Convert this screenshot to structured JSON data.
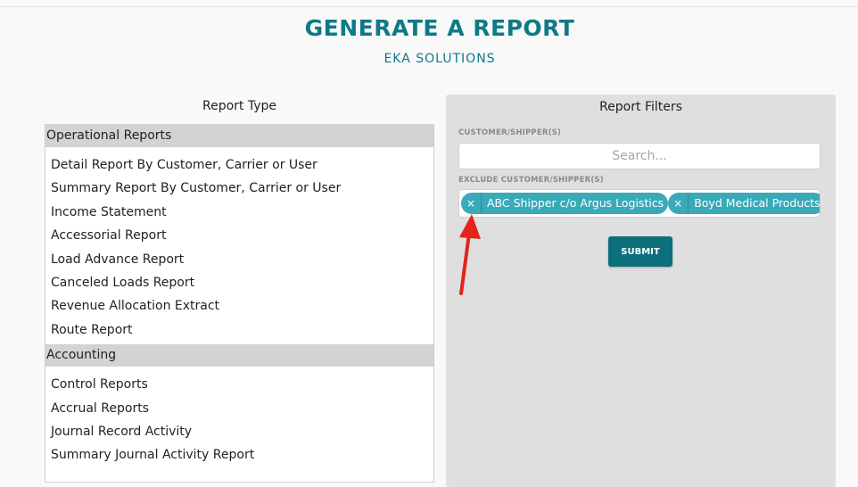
{
  "header": {
    "title": "GENERATE A REPORT",
    "subtitle": "EKA SOLUTIONS"
  },
  "report_type": {
    "heading": "Report Type",
    "groups": [
      {
        "name": "Operational Reports",
        "items": [
          "Detail Report By Customer, Carrier or User",
          "Summary Report By Customer, Carrier or User",
          "Income Statement",
          "Accessorial Report",
          "Load Advance Report",
          "Canceled Loads Report",
          "Revenue Allocation Extract",
          "Route Report"
        ]
      },
      {
        "name": "Accounting",
        "items": [
          "Control Reports",
          "Accrual Reports",
          "Journal Record Activity",
          "Summary Journal Activity Report"
        ]
      }
    ]
  },
  "filters": {
    "heading": "Report Filters",
    "customer_label": "CUSTOMER/SHIPPER(S)",
    "search_placeholder": "Search...",
    "exclude_label": "EXCLUDE CUSTOMER/SHIPPER(S)",
    "excluded_tags": [
      {
        "remove": "×",
        "label": "ABC Shipper c/o Argus Logistics"
      },
      {
        "remove": "×",
        "label": "Boyd Medical Products"
      }
    ],
    "submit_label": "SUBMIT"
  },
  "colors": {
    "accent": "#0e7a85",
    "tag": "#3aaab8",
    "button": "#0e6f7c",
    "annotation_arrow": "#e3231c"
  }
}
